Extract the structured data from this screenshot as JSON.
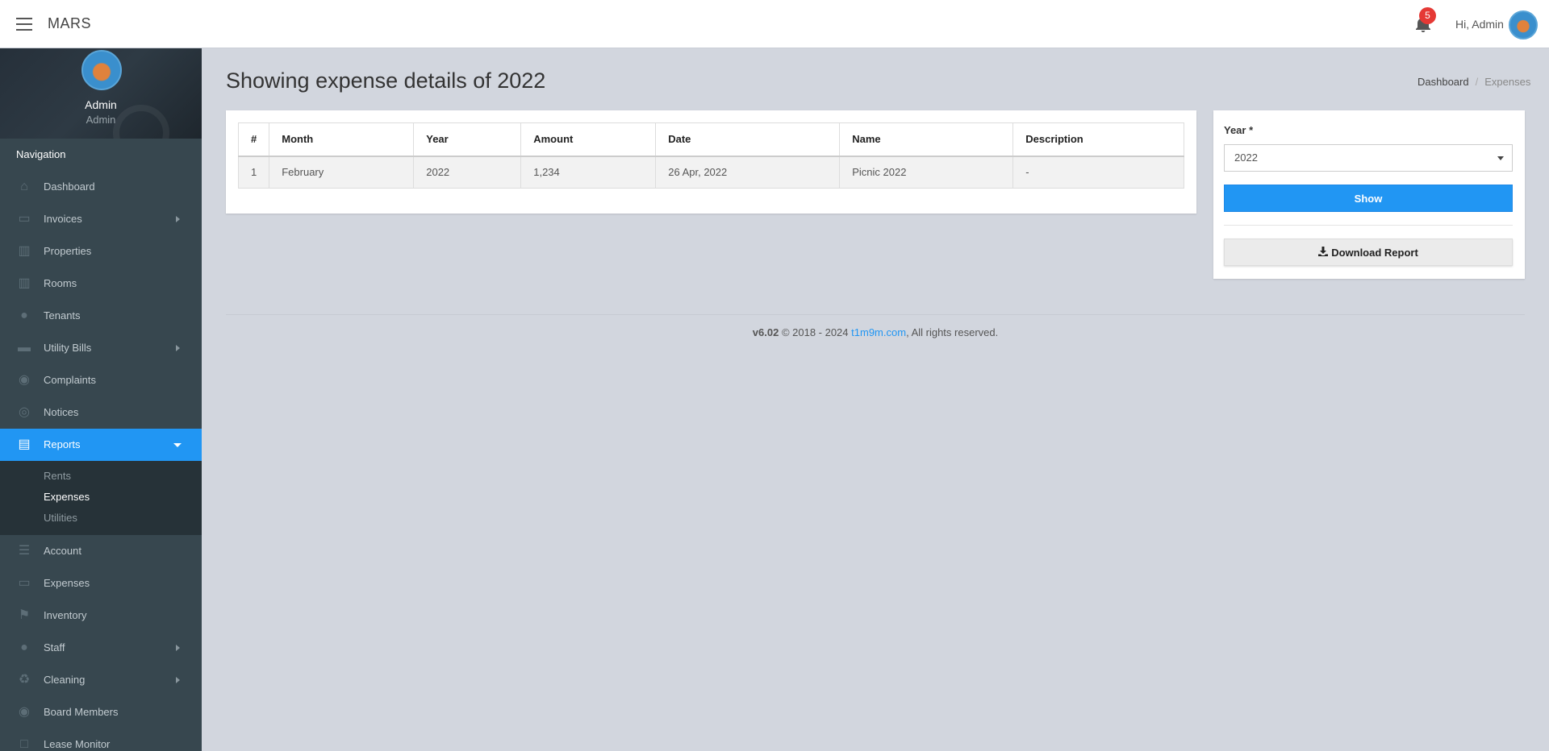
{
  "header": {
    "brand": "MARS",
    "notification_count": "5",
    "greeting": "Hi, Admin"
  },
  "sidebar": {
    "user_name": "Admin",
    "user_role": "Admin",
    "nav_title": "Navigation",
    "items": [
      {
        "label": "Dashboard",
        "icon": "home-icon"
      },
      {
        "label": "Invoices",
        "icon": "credit-card-icon"
      },
      {
        "label": "Properties",
        "icon": "building-icon"
      },
      {
        "label": "Rooms",
        "icon": "building-icon"
      },
      {
        "label": "Tenants",
        "icon": "users-icon"
      },
      {
        "label": "Utility Bills",
        "icon": "money-icon"
      },
      {
        "label": "Complaints",
        "icon": "life-ring-icon"
      },
      {
        "label": "Notices",
        "icon": "broadcast-icon"
      },
      {
        "label": "Reports",
        "icon": "file-excel-icon"
      },
      {
        "label": "Account",
        "icon": "list-icon"
      },
      {
        "label": "Expenses",
        "icon": "card-icon"
      },
      {
        "label": "Inventory",
        "icon": "flag-icon"
      },
      {
        "label": "Staff",
        "icon": "user-icon"
      },
      {
        "label": "Cleaning",
        "icon": "recycle-icon"
      },
      {
        "label": "Board Members",
        "icon": "user-circle-icon"
      },
      {
        "label": "Lease Monitor",
        "icon": "square-icon"
      }
    ],
    "reports_sub": [
      "Rents",
      "Expenses",
      "Utilities"
    ]
  },
  "page": {
    "title": "Showing expense details of 2022",
    "breadcrumb": [
      "Dashboard",
      "Expenses"
    ]
  },
  "table": {
    "headers": [
      "#",
      "Month",
      "Year",
      "Amount",
      "Date",
      "Name",
      "Description"
    ],
    "rows": [
      [
        "1",
        "February",
        "2022",
        "1,234",
        "26 Apr, 2022",
        "Picnic 2022",
        "-"
      ]
    ]
  },
  "form": {
    "year_label": "Year *",
    "year_value": "2022",
    "show_label": "Show",
    "download_label": "Download Report"
  },
  "footer": {
    "version": "v6.02",
    "copyright": "© 2018 - 2024",
    "link": "t1m9m.com",
    "rights": ", All rights reserved."
  },
  "colors": {
    "accent": "#2196f3",
    "sidebar_bg": "#37474f",
    "badge": "#e53935"
  }
}
